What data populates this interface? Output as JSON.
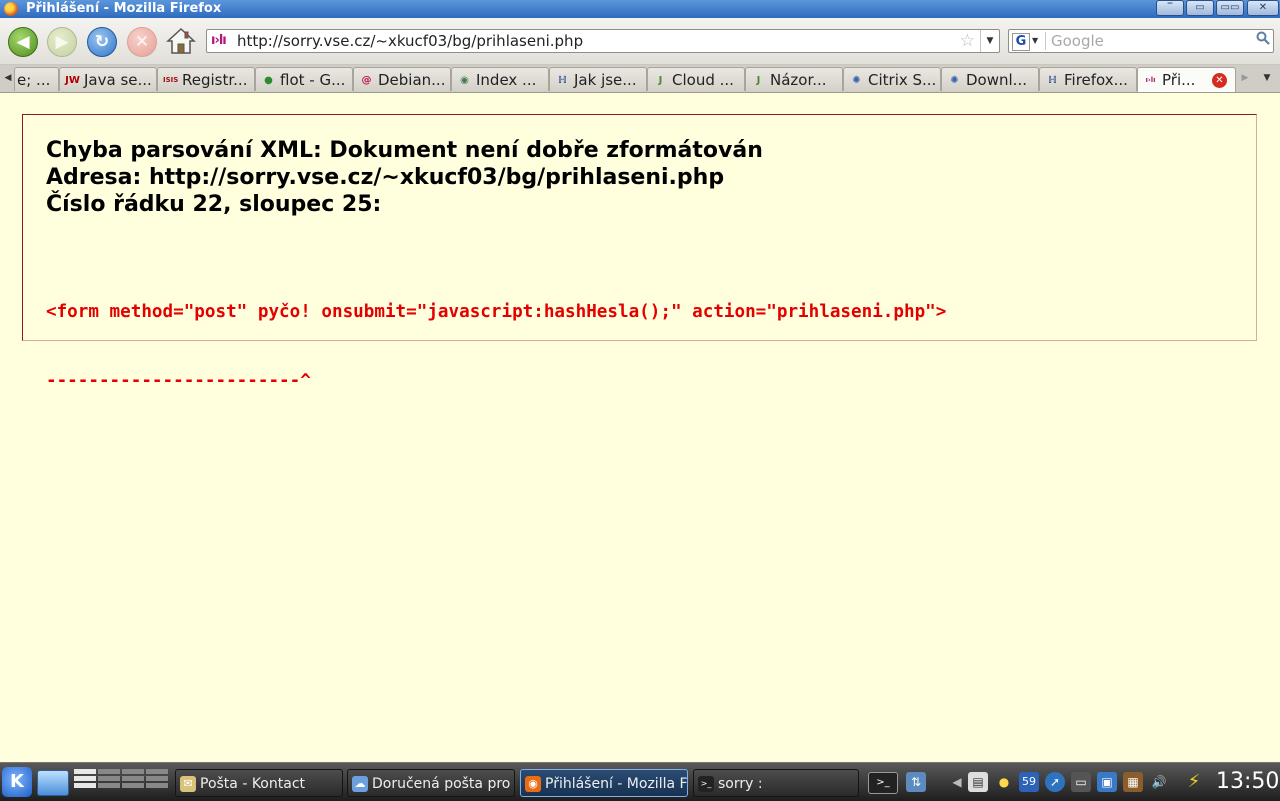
{
  "window": {
    "title": "Přihlášení - Mozilla Firefox",
    "controls": {
      "minimize": "‾",
      "maximize": "▭",
      "close": "✕"
    }
  },
  "nav": {
    "back_icon": "◀",
    "forward_icon": "▶",
    "reload_icon": "↻",
    "stop_icon": "✕",
    "site_icon_text": "ı›lı",
    "url": "http://sorry.vse.cz/~xkucf03/bg/prihlaseni.php",
    "bookmark_star": "☆",
    "url_dropdown": "▼",
    "search_engine": "G",
    "search_engine_arrow": "▼",
    "search_placeholder": "Google",
    "search_icon": "🔍"
  },
  "tabs": [
    {
      "label": "e; ...",
      "icon_text": "",
      "icon_color": "#333333"
    },
    {
      "label": "Java se...",
      "icon_text": "JW",
      "icon_color": "#b00000"
    },
    {
      "label": "Registr...",
      "icon_text": "ISIS",
      "icon_color": "#a01010"
    },
    {
      "label": "flot - G...",
      "icon_text": "●",
      "icon_color": "#2e8b2e"
    },
    {
      "label": "Debian...",
      "icon_text": "@",
      "icon_color": "#c4104a"
    },
    {
      "label": "Index ...",
      "icon_text": "◉",
      "icon_color": "#4a7a4a"
    },
    {
      "label": "Jak jse...",
      "icon_text": "ℍ",
      "icon_color": "#1f3f8f"
    },
    {
      "label": "Cloud ...",
      "icon_text": "J",
      "icon_color": "#4d8a2a"
    },
    {
      "label": "Názor...",
      "icon_text": "J",
      "icon_color": "#4d8a2a"
    },
    {
      "label": "Citrix S...",
      "icon_text": "✺",
      "icon_color": "#3060b0"
    },
    {
      "label": "Downl...",
      "icon_text": "✺",
      "icon_color": "#3060b0"
    },
    {
      "label": "Firefox...",
      "icon_text": "ℍ",
      "icon_color": "#1f3f8f"
    },
    {
      "label": "Při...",
      "icon_text": "ı›lı",
      "icon_color": "#b0177a",
      "active": true
    }
  ],
  "tabstrip": {
    "scroll_left": "◀",
    "scroll_right": "▶",
    "all_tabs": "▼",
    "close_tab": "✕"
  },
  "error": {
    "line1": "Chyba parsování XML: Dokument není dobře zformátován",
    "line2": "Adresa: http://sorry.vse.cz/~xkucf03/bg/prihlaseni.php",
    "line3": "Číslo řádku 22, sloupec 25:",
    "source_line": "<form method=\"post\" pyčo! onsubmit=\"javascript:hashHesla();\" action=\"prihlaseni.php\">",
    "marker_line": "------------------------^"
  },
  "taskbar": {
    "k_menu": "K",
    "tasks": [
      {
        "label": "Pošta - Kontact",
        "icon_text": "✉",
        "icon_color": "#d9c37a"
      },
      {
        "label": "Doručená pošta pro",
        "icon_text": "☁",
        "icon_color": "#6aa0de"
      },
      {
        "label": "Přihlášení - Mozilla F",
        "icon_text": "◉",
        "icon_color": "#e96b13",
        "active": true
      },
      {
        "label": "sorry :",
        "icon_text": ">_",
        "icon_color": "#222222"
      }
    ],
    "clock": "13:50",
    "tray_date_badge": "59"
  }
}
